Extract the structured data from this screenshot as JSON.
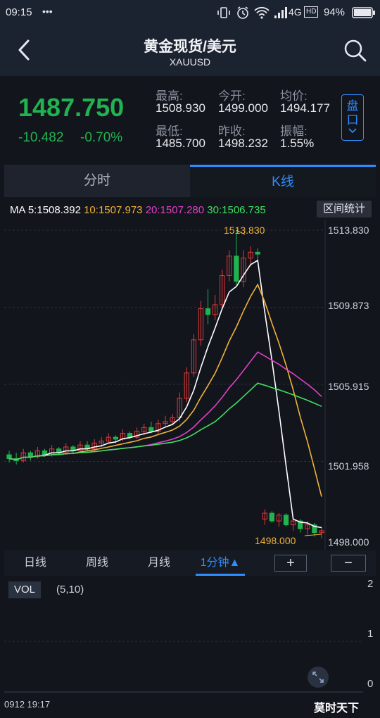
{
  "status": {
    "time": "09:15",
    "network": "4G",
    "hd": "HD",
    "battery": "94%"
  },
  "header": {
    "title": "黄金现货/美元",
    "symbol": "XAUUSD"
  },
  "quote": {
    "price": "1487.750",
    "change": "-10.482",
    "change_pct": "-0.70%",
    "stats": [
      {
        "label": "最高:",
        "value": "1508.930"
      },
      {
        "label": "今开:",
        "value": "1499.000"
      },
      {
        "label": "均价:",
        "value": "1494.177"
      },
      {
        "label": "最低:",
        "value": "1485.700"
      },
      {
        "label": "昨收:",
        "value": "1498.232"
      },
      {
        "label": "振幅:",
        "value": "1.55%"
      }
    ],
    "side_button": "盘口"
  },
  "tabs": [
    {
      "label": "分时"
    },
    {
      "label": "K线"
    }
  ],
  "ma_legend": [
    {
      "label": "MA 5:1508.392",
      "color": "#ffffff"
    },
    {
      "label": "10:1507.973",
      "color": "#f0b23a"
    },
    {
      "label": "20:1507.280",
      "color": "#e040c8"
    },
    {
      "label": "30:1506.735",
      "color": "#3ee060"
    }
  ],
  "interval_stats_button": "区间统计",
  "price_axis": [
    "1513.830",
    "1509.873",
    "1505.915",
    "1501.958",
    "1498.000"
  ],
  "chart_annotations": {
    "high": "1513.830",
    "low": "1498.000"
  },
  "periods": [
    "日线",
    "周线",
    "月线",
    "1分钟▲"
  ],
  "zoom": {
    "plus": "+",
    "minus": "−"
  },
  "vol": {
    "label": "VOL",
    "params": "(5,10)",
    "axis": [
      "2",
      "1",
      "0"
    ]
  },
  "footer": {
    "timestamp": "0912 19:17",
    "watermark": "莫时天下"
  },
  "colors": {
    "up": "#e03a3a",
    "down": "#21b34f",
    "accent": "#2f8cff",
    "bg": "#12151c"
  },
  "chart_data": {
    "type": "candlestick",
    "ylim": [
      1498.0,
      1513.83
    ],
    "high_marker": 1513.83,
    "low_marker": 1498.0,
    "candles": [
      [
        1502.3,
        1502.5,
        1501.9,
        1502.1
      ],
      [
        1502.1,
        1502.4,
        1501.8,
        1502.0
      ],
      [
        1502.0,
        1502.6,
        1501.9,
        1502.4
      ],
      [
        1502.4,
        1502.5,
        1502.0,
        1502.2
      ],
      [
        1502.2,
        1502.7,
        1502.1,
        1502.5
      ],
      [
        1502.5,
        1502.6,
        1502.2,
        1502.3
      ],
      [
        1502.3,
        1502.8,
        1502.2,
        1502.6
      ],
      [
        1502.6,
        1502.7,
        1502.3,
        1502.4
      ],
      [
        1502.4,
        1502.9,
        1502.3,
        1502.7
      ],
      [
        1502.7,
        1502.8,
        1502.4,
        1502.5
      ],
      [
        1502.5,
        1503.0,
        1502.4,
        1502.8
      ],
      [
        1502.8,
        1503.0,
        1502.5,
        1502.6
      ],
      [
        1502.6,
        1503.1,
        1502.5,
        1502.9
      ],
      [
        1502.9,
        1503.2,
        1502.7,
        1503.0
      ],
      [
        1503.0,
        1503.4,
        1502.9,
        1503.2
      ],
      [
        1503.2,
        1503.3,
        1502.9,
        1503.1
      ],
      [
        1503.1,
        1503.6,
        1503.0,
        1503.4
      ],
      [
        1503.4,
        1503.5,
        1503.1,
        1503.2
      ],
      [
        1503.2,
        1503.7,
        1503.1,
        1503.5
      ],
      [
        1503.5,
        1503.9,
        1503.3,
        1503.7
      ],
      [
        1503.7,
        1504.0,
        1503.4,
        1503.5
      ],
      [
        1503.5,
        1504.1,
        1503.4,
        1503.9
      ],
      [
        1503.9,
        1504.3,
        1503.7,
        1504.0
      ],
      [
        1504.0,
        1504.4,
        1503.8,
        1504.2
      ],
      [
        1504.2,
        1505.5,
        1504.0,
        1505.2
      ],
      [
        1505.2,
        1506.8,
        1505.0,
        1506.5
      ],
      [
        1506.5,
        1508.5,
        1506.3,
        1508.2
      ],
      [
        1508.2,
        1510.2,
        1507.9,
        1509.8
      ],
      [
        1509.8,
        1510.8,
        1509.0,
        1509.5
      ],
      [
        1509.5,
        1510.5,
        1509.2,
        1510.0
      ],
      [
        1510.0,
        1511.8,
        1509.8,
        1511.5
      ],
      [
        1511.5,
        1512.8,
        1511.2,
        1512.5
      ],
      [
        1512.5,
        1513.83,
        1511.0,
        1511.2
      ],
      [
        1511.2,
        1512.8,
        1510.9,
        1512.4
      ],
      [
        1512.4,
        1513.0,
        1512.0,
        1512.7
      ],
      [
        1512.7,
        1512.9,
        1512.2,
        1512.6
      ],
      [
        1499.0,
        1499.5,
        1498.7,
        1499.3
      ],
      [
        1499.3,
        1499.4,
        1498.8,
        1498.9
      ],
      [
        1498.9,
        1499.3,
        1498.6,
        1499.2
      ],
      [
        1499.2,
        1499.3,
        1498.6,
        1498.7
      ],
      [
        1498.7,
        1499.1,
        1498.4,
        1498.9
      ],
      [
        1498.9,
        1499.0,
        1498.3,
        1498.5
      ],
      [
        1498.5,
        1498.9,
        1498.2,
        1498.7
      ],
      [
        1498.7,
        1498.8,
        1498.1,
        1498.3
      ],
      [
        1498.3,
        1498.6,
        1498.0,
        1498.4
      ]
    ]
  }
}
